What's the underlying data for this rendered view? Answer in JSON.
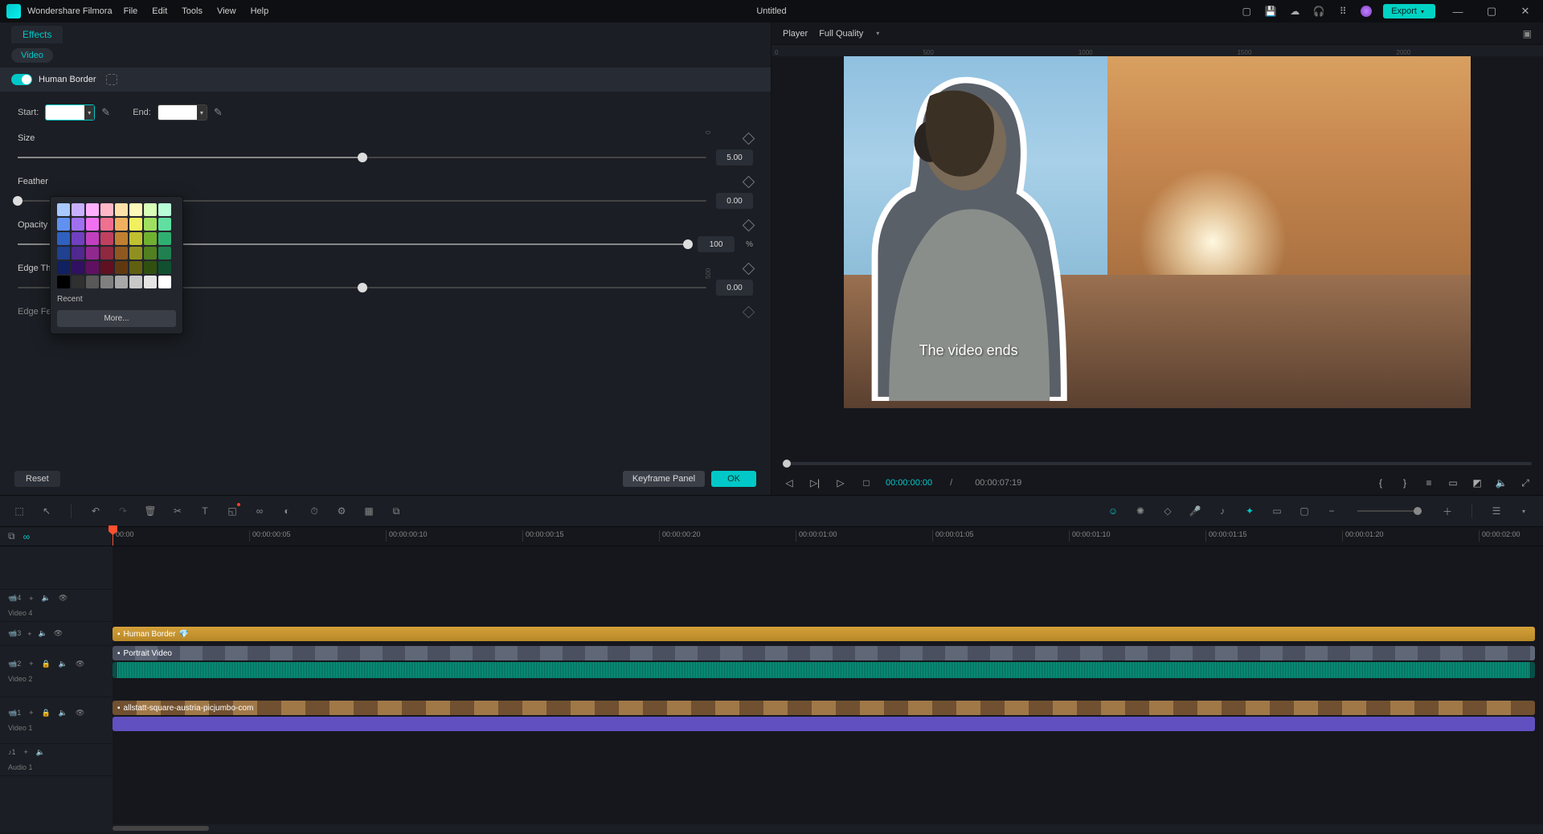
{
  "app": {
    "name": "Wondershare Filmora",
    "document": "Untitled"
  },
  "menu": [
    "File",
    "Edit",
    "Tools",
    "View",
    "Help"
  ],
  "export_label": "Export",
  "left": {
    "tab": "Effects",
    "pill": "Video",
    "effect_name": "Human Border",
    "start_label": "Start:",
    "end_label": "End:",
    "props": [
      {
        "label": "Size",
        "value": "5.00",
        "pos": 50,
        "pct": false
      },
      {
        "label": "Feather",
        "value": "0.00",
        "pos": 0,
        "pct": false
      },
      {
        "label": "Opacity",
        "value": "100",
        "pos": 100,
        "pct": true
      },
      {
        "label": "Edge Thickness",
        "value": "0.00",
        "pos": 50,
        "pct": false
      },
      {
        "label": "Edge Feather",
        "value": "",
        "pos": 0,
        "pct": false
      }
    ],
    "reset": "Reset",
    "keyframe_panel": "Keyframe Panel",
    "ok": "OK",
    "color_popup": {
      "recent": "Recent",
      "more": "More...",
      "swatches": [
        "#a8c8ff",
        "#c8b0ff",
        "#ffb0ff",
        "#ffb8c8",
        "#ffe0a8",
        "#fff8b8",
        "#d8ffb8",
        "#b8ffd8",
        "#6090f0",
        "#a070f0",
        "#f070f0",
        "#f07090",
        "#f0b060",
        "#f0f060",
        "#a0e060",
        "#60e0a0",
        "#3060c0",
        "#7040c0",
        "#c040c0",
        "#c04060",
        "#c08030",
        "#c0c030",
        "#70b030",
        "#30b070",
        "#204090",
        "#502890",
        "#902890",
        "#902840",
        "#905820",
        "#909020",
        "#508020",
        "#208050",
        "#102060",
        "#301060",
        "#601060",
        "#601020",
        "#603810",
        "#606010",
        "#305010",
        "#105030",
        "#000000",
        "#303030",
        "#585858",
        "#808080",
        "#a8a8a8",
        "#c8c8c8",
        "#e4e4e4",
        "#ffffff"
      ]
    }
  },
  "player": {
    "label": "Player",
    "quality": "Full Quality",
    "subtitle": "The video ends",
    "current": "00:00:00:00",
    "total": "00:00:07:19",
    "ruler_marks": [
      "0",
      "500",
      "1000",
      "1500",
      "2000"
    ],
    "vruler_marks": [
      "0",
      "500"
    ]
  },
  "tl_ruler": [
    "00:00",
    "00:00:00:05",
    "00:00:00:10",
    "00:00:00:15",
    "00:00:00:20",
    "00:00:01:00",
    "00:00:01:05",
    "00:00:01:10",
    "00:00:01:15",
    "00:00:01:20",
    "00:00:02:00"
  ],
  "tracks": {
    "video4": "Video 4",
    "video2": "Video 2",
    "video1": "Video 1",
    "audio1": "Audio 1",
    "clip_humborder": "Human Border",
    "clip_portrait": "Portrait Video",
    "clip_bg": "allstatt-square-austria-picjumbo-com"
  }
}
